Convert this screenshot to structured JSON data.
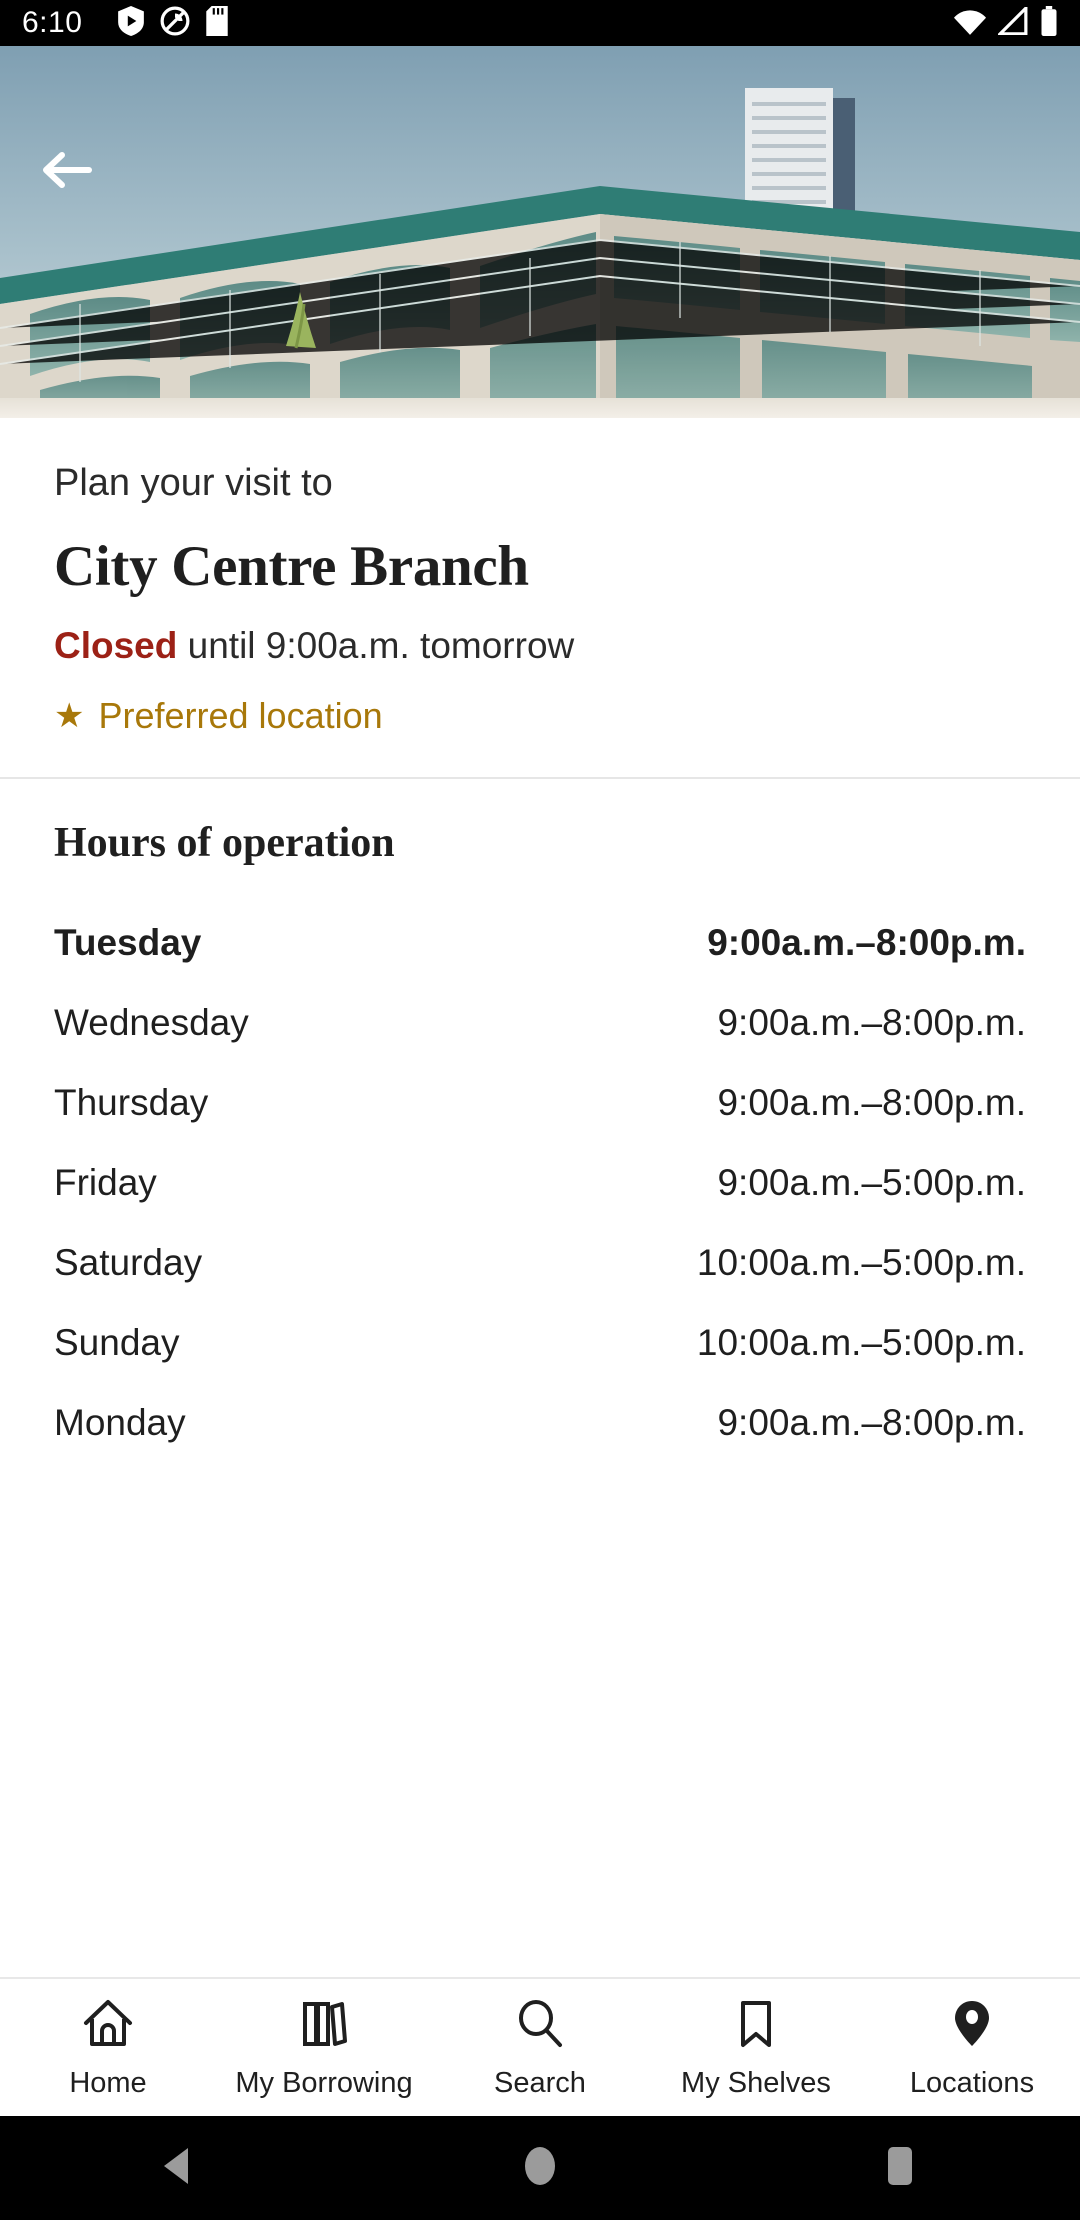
{
  "statusbar": {
    "time": "6:10",
    "left_icons": [
      "play-protect-icon",
      "no-circle-icon",
      "sd-card-icon"
    ],
    "right_icons": [
      "wifi-icon",
      "signal-icon",
      "battery-icon"
    ]
  },
  "hero": {
    "back_icon": "back-arrow-icon",
    "image_alt": "library-building-photo"
  },
  "intro": {
    "eyebrow": "Plan your visit to",
    "branch_name": "City Centre Branch",
    "status_word": "Closed",
    "status_rest": " until 9:00a.m. tomorrow",
    "preferred_label": "Preferred location",
    "star_glyph": "★",
    "status_color": "#9c2116",
    "preferred_color": "#a8780a"
  },
  "hours": {
    "heading": "Hours of operation",
    "rows": [
      {
        "day": "Tuesday",
        "time": "9:00a.m.–8:00p.m.",
        "today": true
      },
      {
        "day": "Wednesday",
        "time": "9:00a.m.–8:00p.m.",
        "today": false
      },
      {
        "day": "Thursday",
        "time": "9:00a.m.–8:00p.m.",
        "today": false
      },
      {
        "day": "Friday",
        "time": "9:00a.m.–5:00p.m.",
        "today": false
      },
      {
        "day": "Saturday",
        "time": "10:00a.m.–5:00p.m.",
        "today": false
      },
      {
        "day": "Sunday",
        "time": "10:00a.m.–5:00p.m.",
        "today": false
      },
      {
        "day": "Monday",
        "time": "9:00a.m.–8:00p.m.",
        "today": false
      }
    ]
  },
  "bottomnav": {
    "items": [
      {
        "label": "Home",
        "icon": "home-icon",
        "active": false
      },
      {
        "label": "My Borrowing",
        "icon": "books-icon",
        "active": false
      },
      {
        "label": "Search",
        "icon": "search-icon",
        "active": false
      },
      {
        "label": "My Shelves",
        "icon": "bookmark-icon",
        "active": false
      },
      {
        "label": "Locations",
        "icon": "location-pin-icon",
        "active": true
      }
    ]
  },
  "sysnav": {
    "back": "android-back-icon",
    "home": "android-home-icon",
    "recents": "android-recents-icon"
  }
}
